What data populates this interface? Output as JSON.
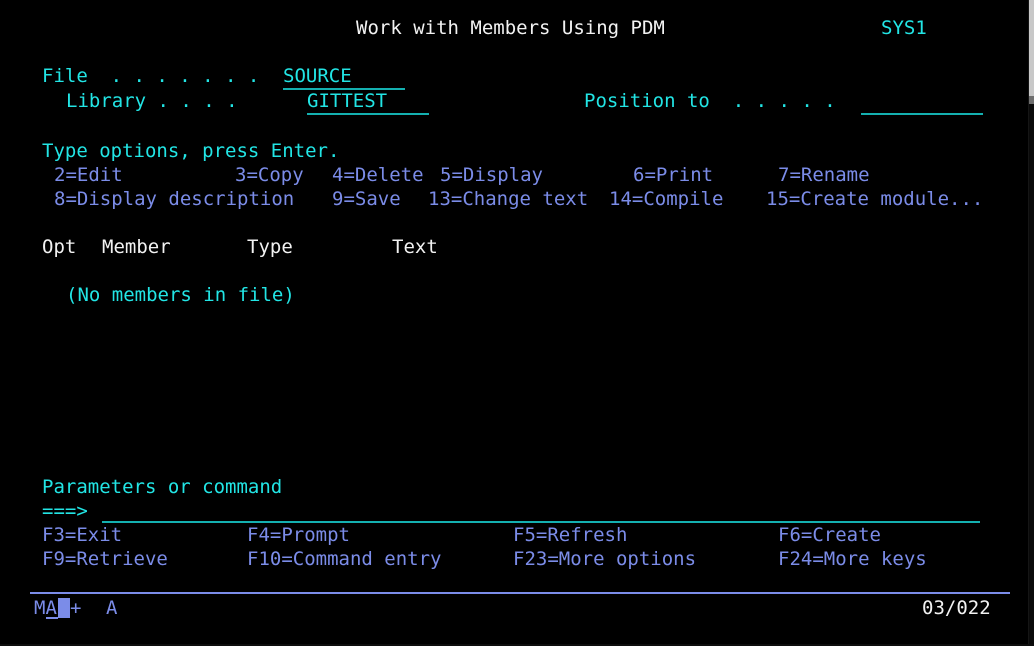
{
  "screen": {
    "title": "Work with Members Using PDM",
    "system_name": "SYS1",
    "rows": 24,
    "columns": 80,
    "colors": {
      "background": "#000000",
      "white": "#f2f2f2",
      "cyan": "#22e5e5",
      "blue": "#7b8ce8",
      "underline": "#14b0b0"
    }
  },
  "header": {
    "file_label": "File  . . . . . . .",
    "file_value": "SOURCE",
    "library_label": "Library . . . .",
    "library_value": "GITTEST",
    "position_to_label": "Position to  . . . . .",
    "position_to_value": ""
  },
  "instructions": {
    "prompt": "Type options, press Enter.",
    "options_row1": [
      {
        "code": "2",
        "label": "2=Edit"
      },
      {
        "code": "3",
        "label": "3=Copy"
      },
      {
        "code": "4",
        "label": "4=Delete"
      },
      {
        "code": "5",
        "label": "5=Display"
      },
      {
        "code": "6",
        "label": "6=Print"
      },
      {
        "code": "7",
        "label": "7=Rename"
      }
    ],
    "options_row2": [
      {
        "code": "8",
        "label": "8=Display description"
      },
      {
        "code": "9",
        "label": "9=Save"
      },
      {
        "code": "13",
        "label": "13=Change text"
      },
      {
        "code": "14",
        "label": "14=Compile"
      },
      {
        "code": "15",
        "label": "15=Create module..."
      }
    ]
  },
  "list": {
    "columns": [
      "Opt",
      "Member",
      "Type",
      "Text"
    ],
    "rows": [],
    "empty_message": "(No members in file)"
  },
  "command": {
    "label": "Parameters or command",
    "prompt": "===>",
    "value": ""
  },
  "function_keys": {
    "row1": [
      {
        "key": "F3",
        "label": "F3=Exit"
      },
      {
        "key": "F4",
        "label": "F4=Prompt"
      },
      {
        "key": "F5",
        "label": "F5=Refresh"
      },
      {
        "key": "F6",
        "label": "F6=Create"
      }
    ],
    "row2": [
      {
        "key": "F9",
        "label": "F9=Retrieve"
      },
      {
        "key": "F10",
        "label": "F10=Command entry"
      },
      {
        "key": "F23",
        "label": "F23=More options"
      },
      {
        "key": "F24",
        "label": "F24=More keys"
      }
    ]
  },
  "status_bar": {
    "mode_indicator": "MA",
    "insert_indicator": "+",
    "keyboard_indicator": "A",
    "cursor_position": "03/022"
  }
}
